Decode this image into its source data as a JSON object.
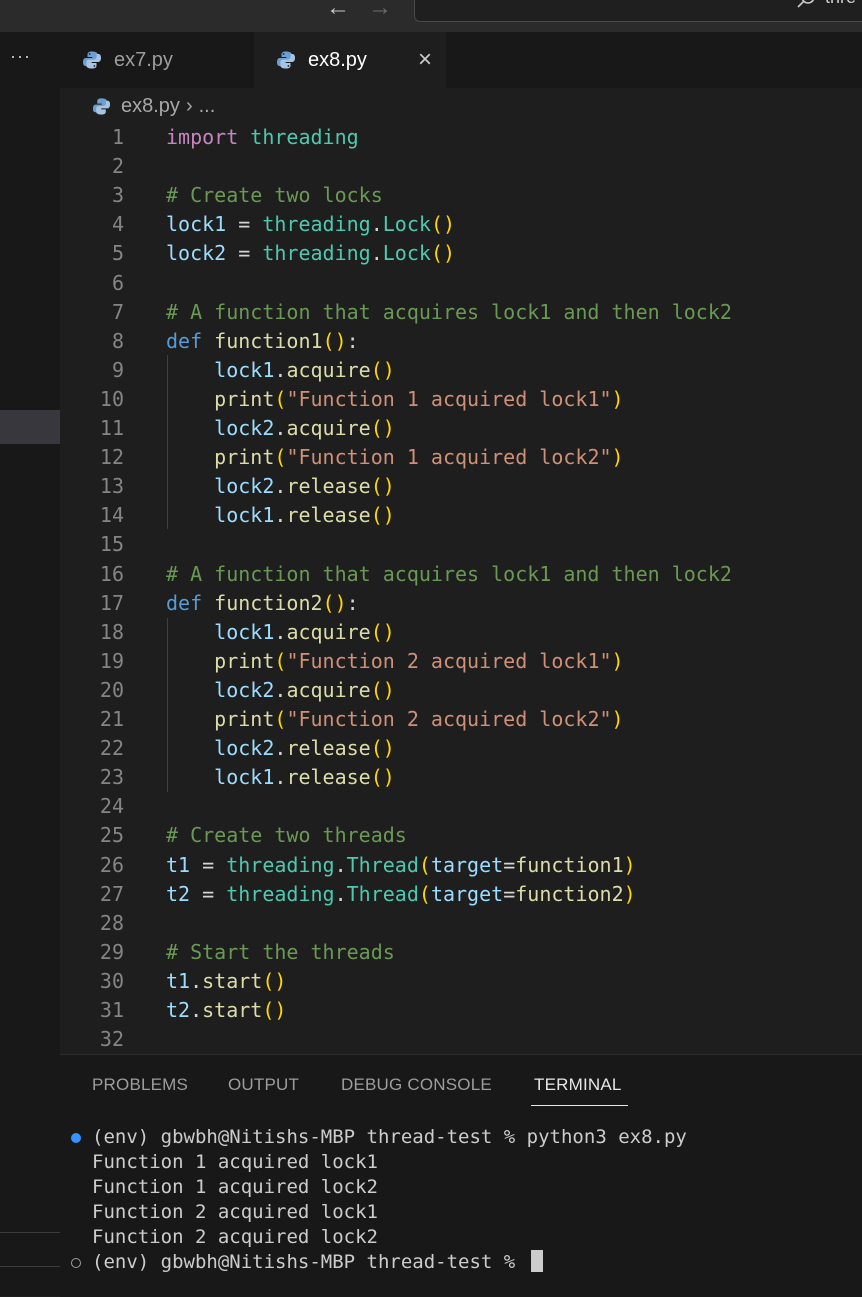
{
  "titlebar": {
    "back_icon": "arrow-left-icon",
    "forward_icon": "arrow-right-icon",
    "search_text": "thre"
  },
  "sidebar": {
    "more_label": "···"
  },
  "tabs": [
    {
      "label": "ex7.py",
      "active": false
    },
    {
      "label": "ex8.py",
      "active": true,
      "close": "×"
    }
  ],
  "breadcrumb": {
    "file": "ex8.py",
    "separator": "›",
    "rest": "..."
  },
  "editor": {
    "line_numbers": [
      "1",
      "2",
      "3",
      "4",
      "5",
      "6",
      "7",
      "8",
      "9",
      "10",
      "11",
      "12",
      "13",
      "14",
      "15",
      "16",
      "17",
      "18",
      "19",
      "20",
      "21",
      "22",
      "23",
      "24",
      "25",
      "26",
      "27",
      "28",
      "29",
      "30",
      "31",
      "32"
    ],
    "lines": [
      [
        [
          "kw",
          "import"
        ],
        [
          "pn",
          " "
        ],
        [
          "ns",
          "threading"
        ]
      ],
      [],
      [
        [
          "com",
          "# Create two locks"
        ]
      ],
      [
        [
          "var",
          "lock1"
        ],
        [
          "pn",
          " = "
        ],
        [
          "ns",
          "threading"
        ],
        [
          "pn",
          "."
        ],
        [
          "ns",
          "Lock"
        ],
        [
          "br",
          "()"
        ]
      ],
      [
        [
          "var",
          "lock2"
        ],
        [
          "pn",
          " = "
        ],
        [
          "ns",
          "threading"
        ],
        [
          "pn",
          "."
        ],
        [
          "ns",
          "Lock"
        ],
        [
          "br",
          "()"
        ]
      ],
      [],
      [
        [
          "com",
          "# A function that acquires lock1 and then lock2"
        ]
      ],
      [
        [
          "def",
          "def"
        ],
        [
          "pn",
          " "
        ],
        [
          "fn",
          "function1"
        ],
        [
          "br",
          "()"
        ],
        [
          "pn",
          ":"
        ]
      ],
      [
        [
          "pn",
          "    "
        ],
        [
          "var",
          "lock1"
        ],
        [
          "pn",
          "."
        ],
        [
          "fn",
          "acquire"
        ],
        [
          "br",
          "()"
        ]
      ],
      [
        [
          "pn",
          "    "
        ],
        [
          "fn",
          "print"
        ],
        [
          "br",
          "("
        ],
        [
          "str",
          "\"Function 1 acquired lock1\""
        ],
        [
          "br",
          ")"
        ]
      ],
      [
        [
          "pn",
          "    "
        ],
        [
          "var",
          "lock2"
        ],
        [
          "pn",
          "."
        ],
        [
          "fn",
          "acquire"
        ],
        [
          "br",
          "()"
        ]
      ],
      [
        [
          "pn",
          "    "
        ],
        [
          "fn",
          "print"
        ],
        [
          "br",
          "("
        ],
        [
          "str",
          "\"Function 1 acquired lock2\""
        ],
        [
          "br",
          ")"
        ]
      ],
      [
        [
          "pn",
          "    "
        ],
        [
          "var",
          "lock2"
        ],
        [
          "pn",
          "."
        ],
        [
          "fn",
          "release"
        ],
        [
          "br",
          "()"
        ]
      ],
      [
        [
          "pn",
          "    "
        ],
        [
          "var",
          "lock1"
        ],
        [
          "pn",
          "."
        ],
        [
          "fn",
          "release"
        ],
        [
          "br",
          "()"
        ]
      ],
      [],
      [
        [
          "com",
          "# A function that acquires lock1 and then lock2"
        ]
      ],
      [
        [
          "def",
          "def"
        ],
        [
          "pn",
          " "
        ],
        [
          "fn",
          "function2"
        ],
        [
          "br",
          "()"
        ],
        [
          "pn",
          ":"
        ]
      ],
      [
        [
          "pn",
          "    "
        ],
        [
          "var",
          "lock1"
        ],
        [
          "pn",
          "."
        ],
        [
          "fn",
          "acquire"
        ],
        [
          "br",
          "()"
        ]
      ],
      [
        [
          "pn",
          "    "
        ],
        [
          "fn",
          "print"
        ],
        [
          "br",
          "("
        ],
        [
          "str",
          "\"Function 2 acquired lock1\""
        ],
        [
          "br",
          ")"
        ]
      ],
      [
        [
          "pn",
          "    "
        ],
        [
          "var",
          "lock2"
        ],
        [
          "pn",
          "."
        ],
        [
          "fn",
          "acquire"
        ],
        [
          "br",
          "()"
        ]
      ],
      [
        [
          "pn",
          "    "
        ],
        [
          "fn",
          "print"
        ],
        [
          "br",
          "("
        ],
        [
          "str",
          "\"Function 2 acquired lock2\""
        ],
        [
          "br",
          ")"
        ]
      ],
      [
        [
          "pn",
          "    "
        ],
        [
          "var",
          "lock2"
        ],
        [
          "pn",
          "."
        ],
        [
          "fn",
          "release"
        ],
        [
          "br",
          "()"
        ]
      ],
      [
        [
          "pn",
          "    "
        ],
        [
          "var",
          "lock1"
        ],
        [
          "pn",
          "."
        ],
        [
          "fn",
          "release"
        ],
        [
          "br",
          "()"
        ]
      ],
      [],
      [
        [
          "com",
          "# Create two threads"
        ]
      ],
      [
        [
          "var",
          "t1"
        ],
        [
          "pn",
          " = "
        ],
        [
          "ns",
          "threading"
        ],
        [
          "pn",
          "."
        ],
        [
          "ns",
          "Thread"
        ],
        [
          "br",
          "("
        ],
        [
          "var",
          "target"
        ],
        [
          "pn",
          "="
        ],
        [
          "fn",
          "function1"
        ],
        [
          "br",
          ")"
        ]
      ],
      [
        [
          "var",
          "t2"
        ],
        [
          "pn",
          " = "
        ],
        [
          "ns",
          "threading"
        ],
        [
          "pn",
          "."
        ],
        [
          "ns",
          "Thread"
        ],
        [
          "br",
          "("
        ],
        [
          "var",
          "target"
        ],
        [
          "pn",
          "="
        ],
        [
          "fn",
          "function2"
        ],
        [
          "br",
          ")"
        ]
      ],
      [],
      [
        [
          "com",
          "# Start the threads"
        ]
      ],
      [
        [
          "var",
          "t1"
        ],
        [
          "pn",
          "."
        ],
        [
          "fn",
          "start"
        ],
        [
          "br",
          "()"
        ]
      ],
      [
        [
          "var",
          "t2"
        ],
        [
          "pn",
          "."
        ],
        [
          "fn",
          "start"
        ],
        [
          "br",
          "()"
        ]
      ],
      []
    ]
  },
  "panel": {
    "tabs": {
      "problems": "PROBLEMS",
      "output": "OUTPUT",
      "debug": "DEBUG CONSOLE",
      "terminal": "TERMINAL"
    },
    "terminal_lines": [
      "(env) gbwbh@Nitishs-MBP thread-test % python3 ex8.py",
      "Function 1 acquired lock1",
      "Function 1 acquired lock2",
      "Function 2 acquired lock1",
      "Function 2 acquired lock2",
      "(env) gbwbh@Nitishs-MBP thread-test % "
    ]
  },
  "colors": {
    "keyword": "#c586c0",
    "def": "#569cd6",
    "namespace": "#4ec9b0",
    "variable": "#9cdcfe",
    "function": "#dcdcaa",
    "string": "#ce9178",
    "comment": "#6a9955",
    "bracket": "#ffd700",
    "status_dot": "#3794ff"
  }
}
